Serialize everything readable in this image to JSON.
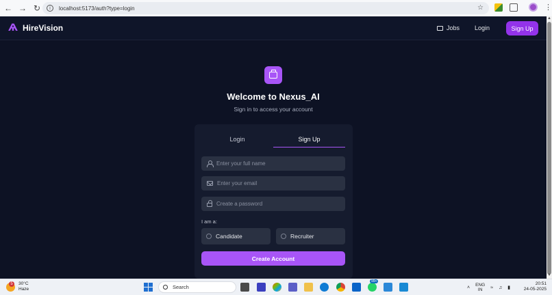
{
  "browser": {
    "url": "localhost:5173/auth?type=login",
    "back_icon": "arrow-left-icon",
    "forward_icon": "arrow-right-icon",
    "reload_icon": "reload-icon"
  },
  "navbar": {
    "brand": "HireVision",
    "links": {
      "jobs": "Jobs",
      "login": "Login"
    },
    "signup_label": "Sign Up",
    "accent": "#9333ea"
  },
  "hero": {
    "title": "Welcome to Nexus_AI",
    "subtitle": "Sign in to access your account"
  },
  "auth_card": {
    "tabs": [
      {
        "label": "Login",
        "active": false
      },
      {
        "label": "Sign Up",
        "active": true
      }
    ],
    "fields": {
      "full_name": {
        "placeholder": "Enter your full name",
        "value": ""
      },
      "email": {
        "placeholder": "Enter your email",
        "value": ""
      },
      "password": {
        "placeholder": "Create a password",
        "value": ""
      }
    },
    "role_label": "I am a:",
    "roles": [
      "Candidate",
      "Recruiter"
    ],
    "submit_label": "Create Account",
    "accent": "#a855f7"
  },
  "taskbar": {
    "weather": {
      "temp": "30°C",
      "condition": "Haze",
      "badge": "5"
    },
    "search_label": "Search",
    "notification_badge": "99+",
    "lang": {
      "top": "ENG",
      "bottom": "IN"
    },
    "time": "20:51",
    "date": "24-05-2025"
  }
}
